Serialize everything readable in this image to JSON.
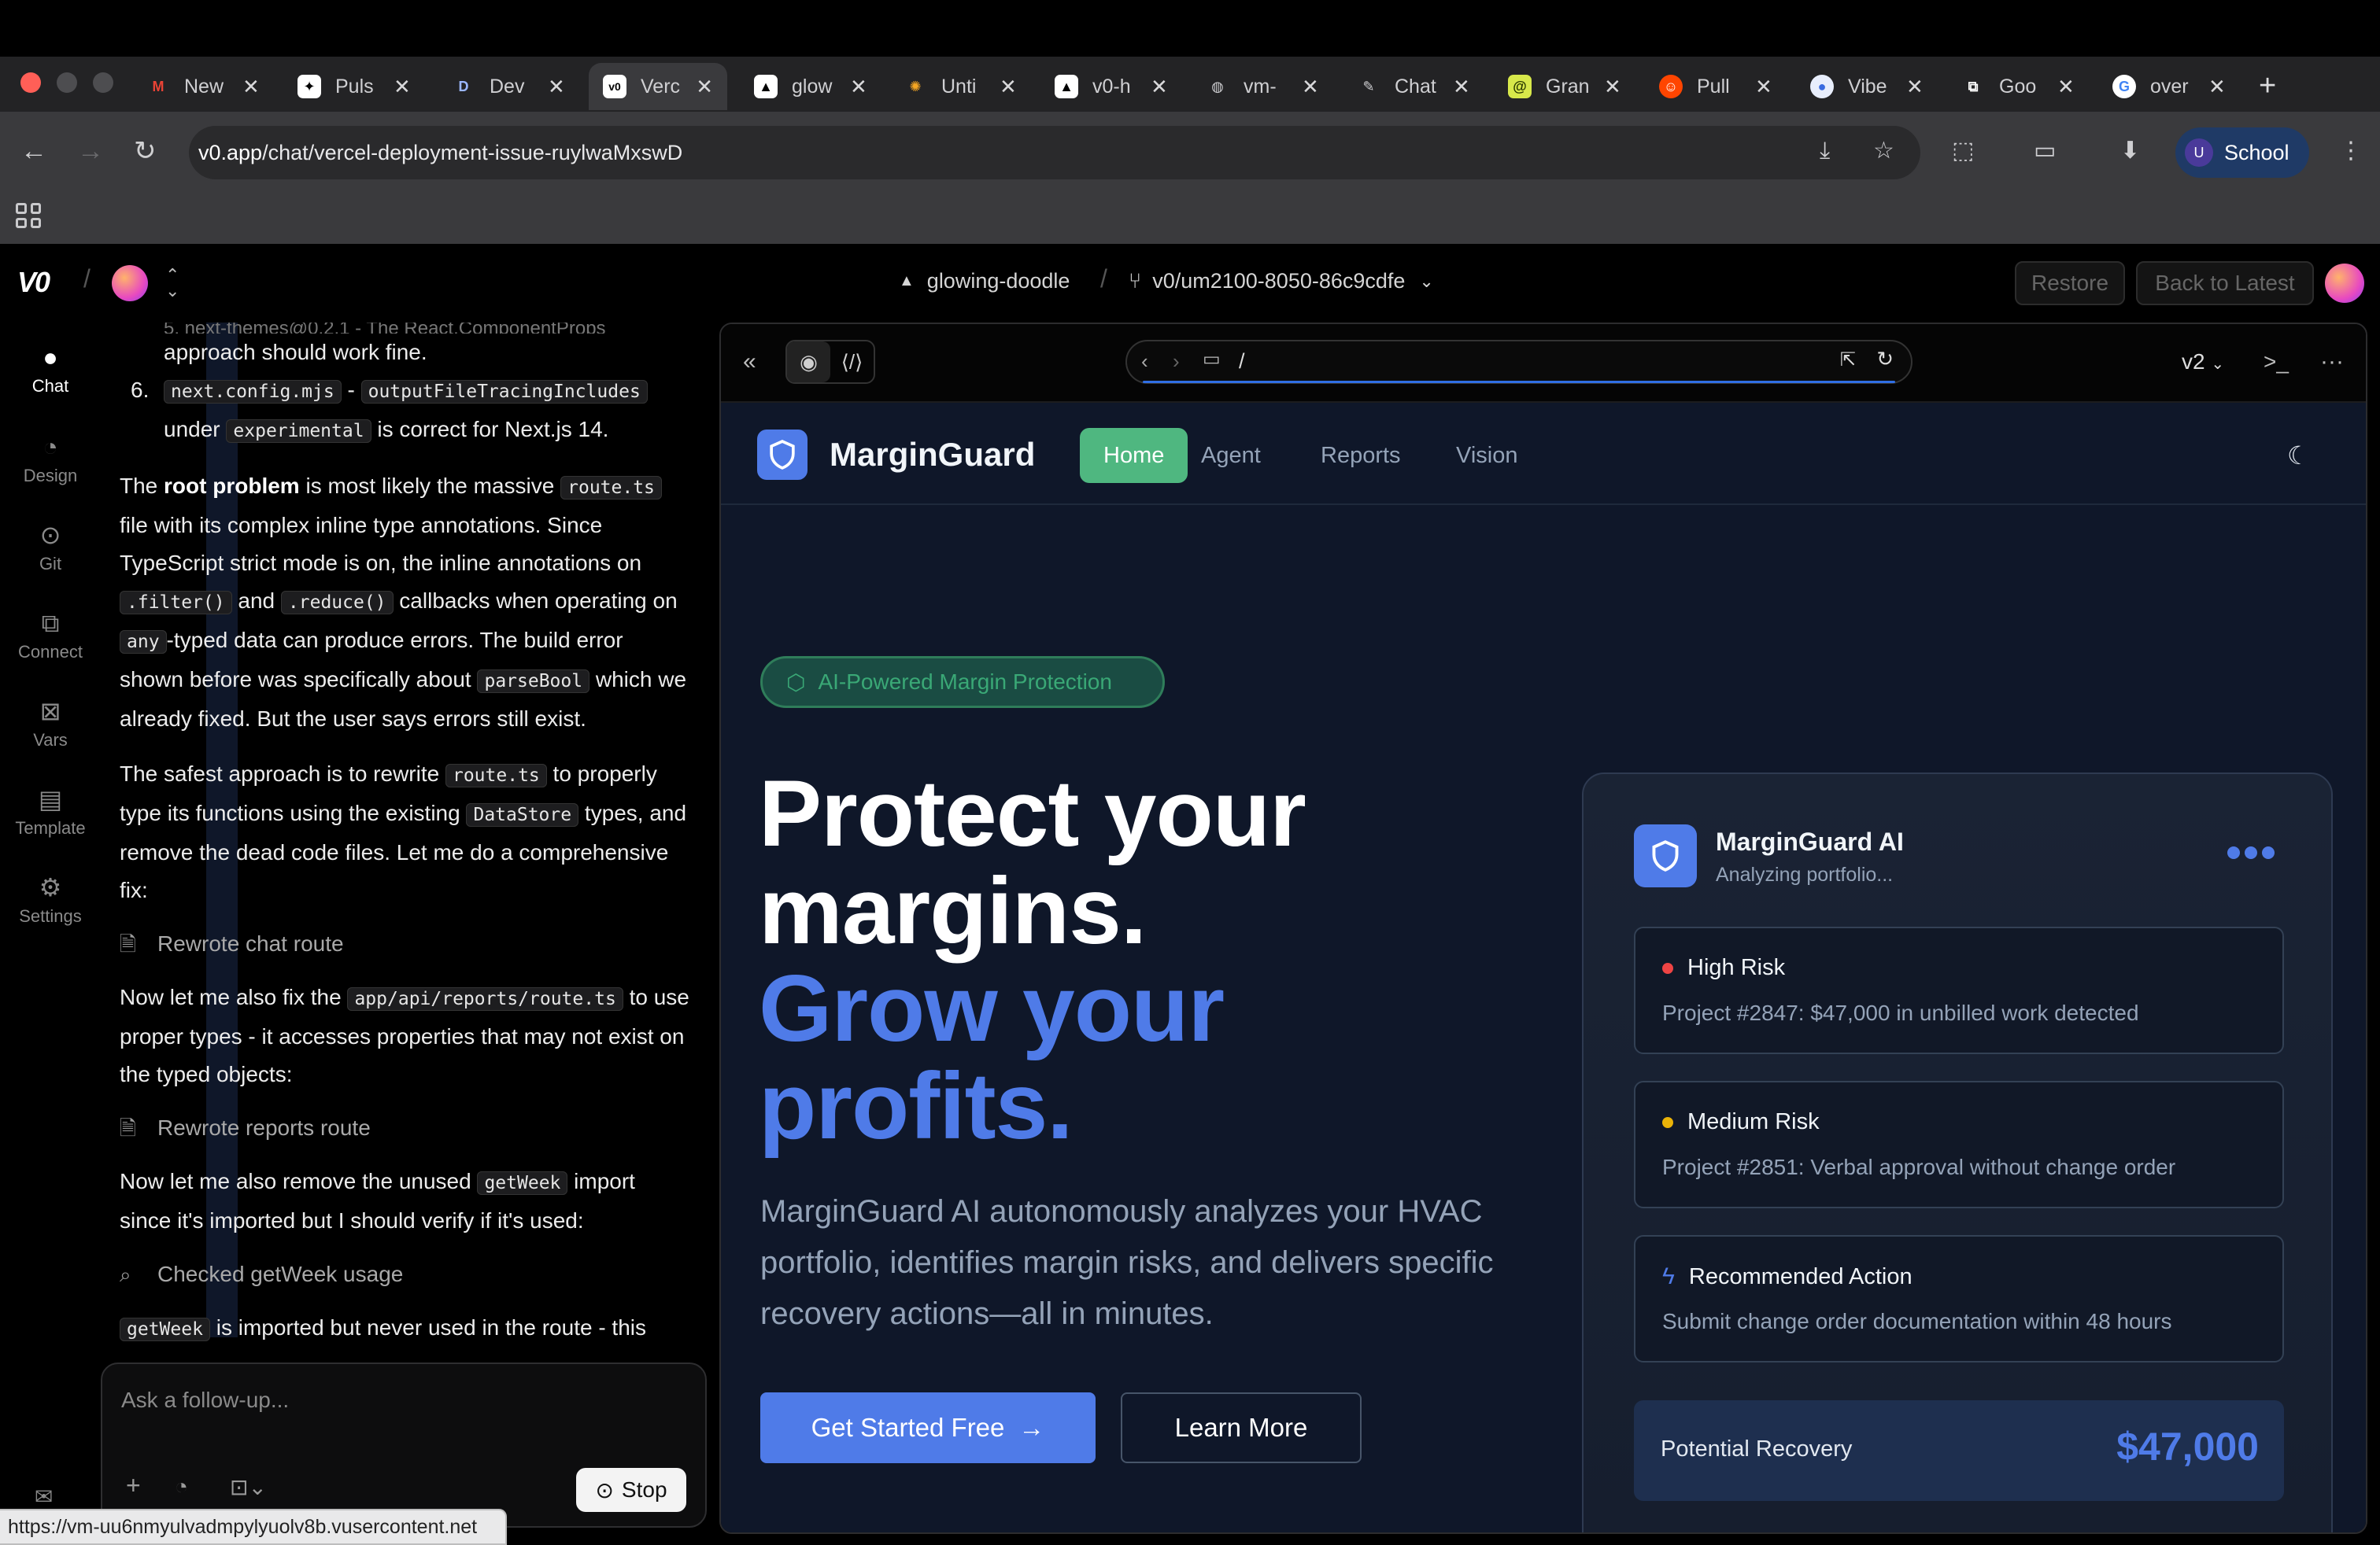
{
  "browser": {
    "tabs": [
      {
        "title": "New",
        "icon": "gmail-icon"
      },
      {
        "title": "Puls",
        "icon": "pulse-icon"
      },
      {
        "title": "Dev",
        "icon": "d-icon"
      },
      {
        "title": "Verc",
        "icon": "v0-icon"
      },
      {
        "title": "glow",
        "icon": "vercel-triangle-icon"
      },
      {
        "title": "Unti",
        "icon": "colorful-icon"
      },
      {
        "title": "v0-h",
        "icon": "vercel-triangle-icon"
      },
      {
        "title": "vm-",
        "icon": "globe-icon"
      },
      {
        "title": "Chat",
        "icon": "chat-icon"
      },
      {
        "title": "Gran",
        "icon": "spiral-icon"
      },
      {
        "title": "Pull",
        "icon": "reddit-icon"
      },
      {
        "title": "Vibe",
        "icon": "drop-icon"
      },
      {
        "title": "Goo",
        "icon": "square-arrow-icon"
      },
      {
        "title": "over",
        "icon": "google-icon"
      }
    ],
    "url_host": "v0.app",
    "url_path": "/chat/vercel-deployment-issue-ruylwaMxswD",
    "profile_initial": "U",
    "profile_name": "School",
    "status_url": "https://vm-uu6nmyulvadmpylyuolv8b.vusercontent.net"
  },
  "app": {
    "project_name": "glowing-doodle",
    "branch": "v0/um2100-8050-86c9cdfe",
    "restore_label": "Restore",
    "back_to_latest_label": "Back to Latest"
  },
  "rail": [
    {
      "label": "Chat",
      "icon": "chat-bubble-icon"
    },
    {
      "label": "Design",
      "icon": "design-icon"
    },
    {
      "label": "Git",
      "icon": "git-icon"
    },
    {
      "label": "Connect",
      "icon": "connect-icon"
    },
    {
      "label": "Vars",
      "icon": "vars-icon"
    },
    {
      "label": "Template",
      "icon": "template-icon"
    },
    {
      "label": "Settings",
      "icon": "settings-gear-icon"
    }
  ],
  "chat": {
    "top_partial": "5. next-themes@0.2.1 - The React.ComponentProps",
    "item5_rest": "approach should work fine.",
    "item6_num": "6.",
    "item6_code1": "next.config.mjs",
    "item6_dash": " - ",
    "item6_code2": "outputFileTracingIncludes",
    "item6_under": "under",
    "item6_code3": "experimental",
    "item6_tail": "is correct for Next.js 14.",
    "p1_a": "The ",
    "p1_bold": "root problem",
    "p1_b": " is most likely the massive ",
    "p1_code1": "route.ts",
    "p1_c": " file with its complex inline type annotations. Since TypeScript strict mode is on, the inline annotations on ",
    "p1_code2": ".filter()",
    "p1_d": " and ",
    "p1_code3": ".reduce()",
    "p1_e": " callbacks when operating on ",
    "p1_code4": "any",
    "p1_f": "-typed data can produce errors. The build error shown before was specifically about ",
    "p1_code5": "parseBool",
    "p1_g": " which we already fixed. But the user says errors still exist.",
    "p2_a": "The safest approach is to rewrite ",
    "p2_code1": "route.ts",
    "p2_b": " to properly type its functions using the existing ",
    "p2_code2": "DataStore",
    "p2_c": " types, and remove the dead code files. Let me do a comprehensive fix:",
    "tool1": "Rewrote chat route",
    "p3_a": "Now let me also fix the ",
    "p3_code": "app/api/reports/route.ts",
    "p3_b": " to use proper types - it accesses properties that may not exist on the typed objects:",
    "tool2": "Rewrote reports route",
    "p4_a": "Now let me also remove the unused ",
    "p4_code": "getWeek",
    "p4_b": " import since it's imported but I should verify if it's used:",
    "tool3": "Checked getWeek usage",
    "p5_code": "getWeek",
    "p5_b": " is imported but never used in the route - this",
    "composer_placeholder": "Ask a follow-up...",
    "stop_label": "Stop"
  },
  "preview": {
    "path": "/",
    "version": "v2",
    "site": {
      "brand": "MarginGuard",
      "nav": [
        "Home",
        "Agent",
        "Reports",
        "Vision"
      ],
      "active_nav": "Home",
      "badge": "AI-Powered Margin Protection",
      "hero_line1": "Protect your",
      "hero_line2": "margins.",
      "hero_line3": "Grow your",
      "hero_line4": "profits.",
      "lede": "MarginGuard AI autonomously analyzes your HVAC portfolio, identifies margin risks, and delivers specific recovery actions—all in minutes.",
      "cta_primary": "Get Started Free",
      "cta_secondary": "Learn More",
      "card": {
        "title": "MarginGuard AI",
        "subtitle": "Analyzing portfolio...",
        "items": [
          {
            "heading": "High Risk",
            "body": "Project #2847: $47,000 in unbilled work detected",
            "color": "#ef4444"
          },
          {
            "heading": "Medium Risk",
            "body": "Project #2851: Verbal approval without change order",
            "color": "#eab308"
          },
          {
            "heading": "Recommended Action",
            "body": "Submit change order documentation within 48 hours",
            "color": "#4f7be8"
          }
        ],
        "recovery_label": "Potential Recovery",
        "recovery_value": "$47,000"
      }
    }
  },
  "colors": {
    "accent": "#4f7be8",
    "nav_active": "#4fb780",
    "site_bg": "#0f1729"
  }
}
